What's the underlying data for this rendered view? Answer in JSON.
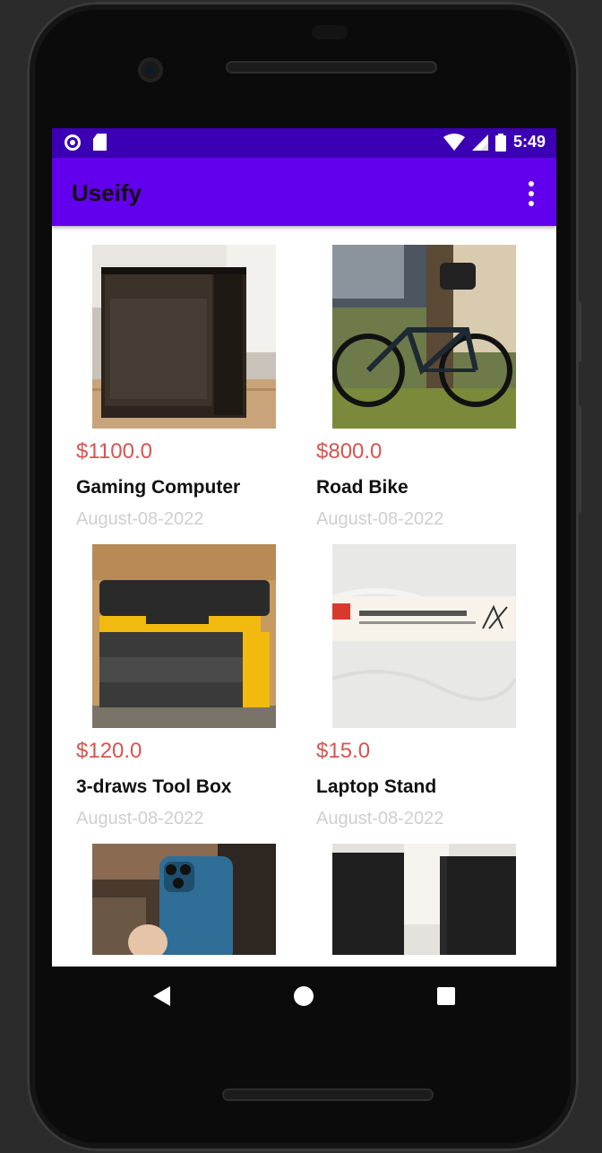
{
  "status_bar": {
    "time": "5:49",
    "icons": [
      "notification-circle-icon",
      "sd-card-icon",
      "wifi-icon",
      "signal-icon",
      "battery-icon"
    ]
  },
  "app_bar": {
    "title": "Useify",
    "menu_icon": "overflow-menu-icon"
  },
  "products": [
    {
      "price": "$1100.0",
      "name": "Gaming Computer",
      "date": "August-08-2022",
      "image": "gaming-computer-photo"
    },
    {
      "price": "$800.0",
      "name": "Road Bike",
      "date": "August-08-2022",
      "image": "road-bike-photo"
    },
    {
      "price": "$120.0",
      "name": "3-draws Tool Box",
      "date": "August-08-2022",
      "image": "tool-box-photo"
    },
    {
      "price": "$15.0",
      "name": "Laptop Stand",
      "date": "August-08-2022",
      "image": "laptop-stand-photo"
    },
    {
      "price": "",
      "name": "",
      "date": "",
      "image": "iphone-photo"
    },
    {
      "price": "",
      "name": "",
      "date": "",
      "image": "speakers-photo"
    }
  ],
  "colors": {
    "status_bar": "#3b00b3",
    "app_bar": "#6200ee",
    "price": "#d9534f",
    "date": "#cfcfcf"
  },
  "nav_bar": {
    "icons": [
      "back-icon",
      "home-icon",
      "recent-apps-icon"
    ]
  }
}
